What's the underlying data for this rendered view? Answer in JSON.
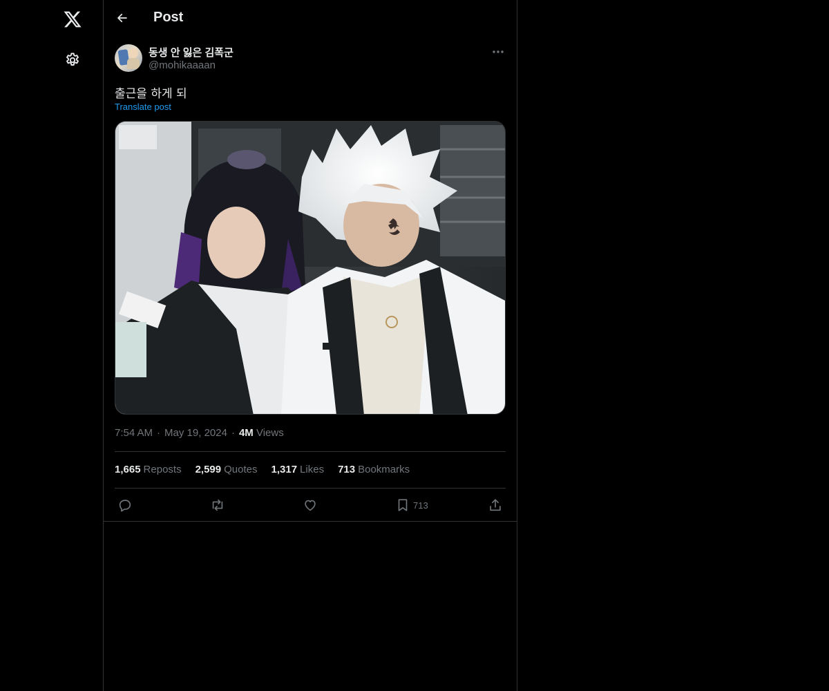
{
  "header": {
    "back_icon": "arrow-left-icon",
    "title": "Post"
  },
  "nav": {
    "logo_icon": "x-logo-icon",
    "settings_icon": "gear-icon"
  },
  "post": {
    "author": {
      "display_name": "동생 안 잃은 김폭군",
      "handle": "@mohikaaaan"
    },
    "text": "출근을 하게 되",
    "translate_label": "Translate post",
    "meta": {
      "time": "7:54 AM",
      "date": "May 19, 2024",
      "views_count": "4M",
      "views_label": "Views",
      "separator": "·"
    },
    "stats": [
      {
        "count": "1,665",
        "label": "Reposts"
      },
      {
        "count": "2,599",
        "label": "Quotes"
      },
      {
        "count": "1,317",
        "label": "Likes"
      },
      {
        "count": "713",
        "label": "Bookmarks"
      }
    ],
    "actions": {
      "reply_icon": "reply-icon",
      "repost_icon": "repost-icon",
      "like_icon": "heart-icon",
      "bookmark_icon": "bookmark-icon",
      "bookmark_count": "713",
      "share_icon": "share-icon"
    }
  },
  "colors": {
    "background": "#000000",
    "text": "#e7e9ea",
    "muted": "#71767b",
    "link": "#1d9bf0",
    "border": "#2f3336"
  }
}
